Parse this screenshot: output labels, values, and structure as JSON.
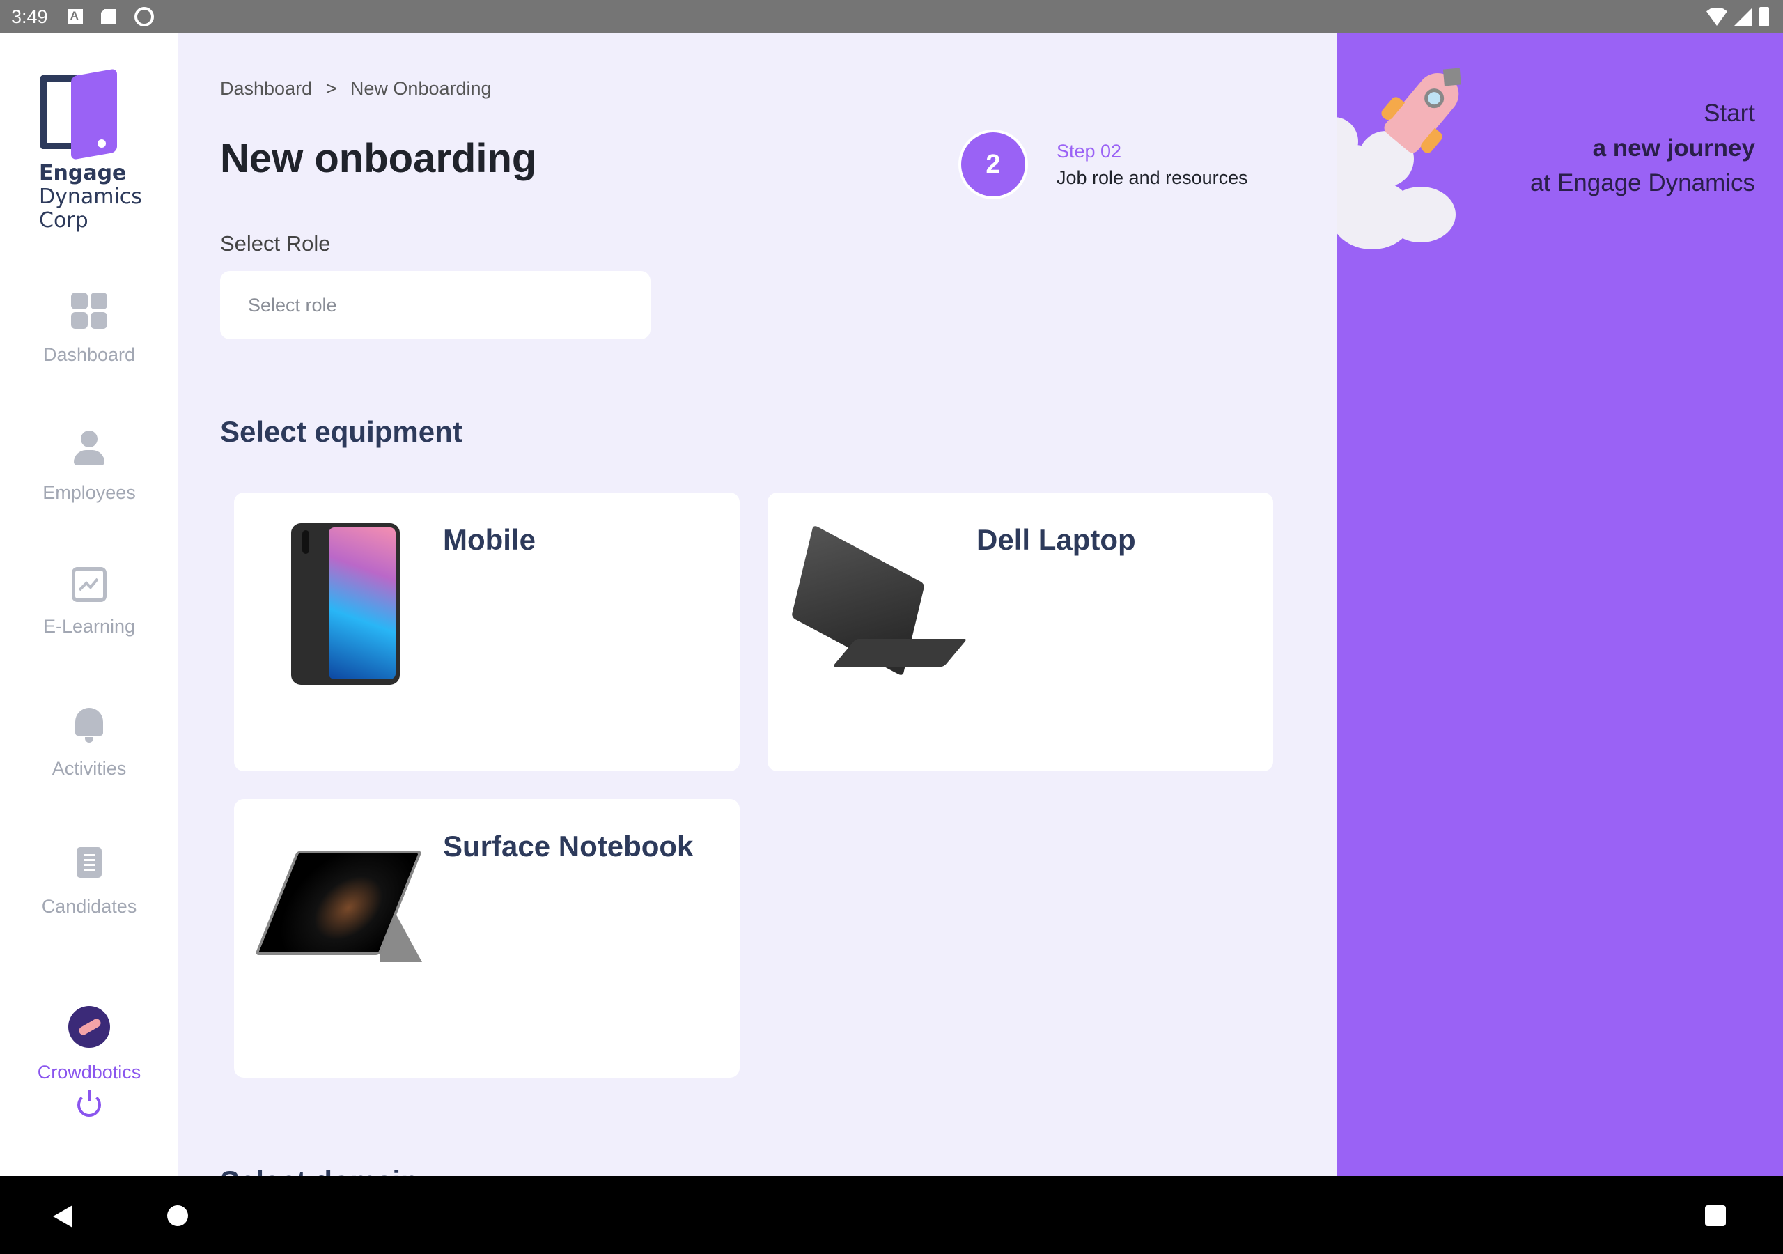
{
  "status_bar": {
    "time": "3:49"
  },
  "brand": {
    "line1": "Engage",
    "line2": "Dynamics",
    "line3": "Corp"
  },
  "sidebar": {
    "items": [
      {
        "label": "Dashboard",
        "icon": "dashboard-grid-icon"
      },
      {
        "label": "Employees",
        "icon": "person-icon"
      },
      {
        "label": "E-Learning",
        "icon": "chart-icon"
      },
      {
        "label": "Activities",
        "icon": "bell-icon"
      },
      {
        "label": "Candidates",
        "icon": "document-icon"
      }
    ],
    "user": {
      "name": "Crowdbotics",
      "icon": "power-icon"
    }
  },
  "breadcrumb": {
    "root": "Dashboard",
    "separator": ">",
    "current": "New Onboarding"
  },
  "page": {
    "title": "New onboarding"
  },
  "step": {
    "number": "2",
    "label": "Step 02",
    "description": "Job role and resources"
  },
  "role": {
    "label": "Select Role",
    "placeholder": "Select role"
  },
  "equipment": {
    "title": "Select equipment",
    "items": [
      {
        "name": "Mobile"
      },
      {
        "name": "Dell Laptop"
      },
      {
        "name": "Surface Notebook"
      }
    ]
  },
  "next_section": {
    "title": "Select domain"
  },
  "promo": {
    "line1": "Start",
    "line2": "a new journey",
    "line3": "at Engage Dynamics"
  },
  "colors": {
    "accent": "#9a62f5",
    "navy": "#2d3a5b",
    "background": "#f1effc"
  }
}
